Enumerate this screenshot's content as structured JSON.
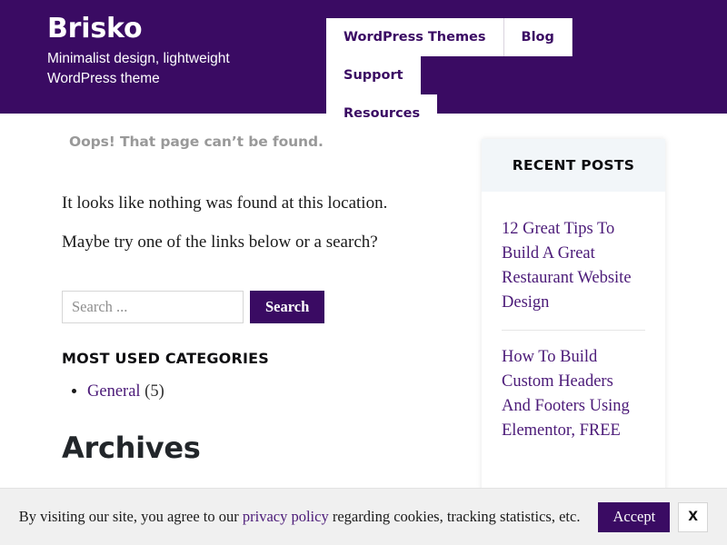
{
  "header": {
    "brand_title": "Brisko",
    "brand_tagline": "Minimalist design, lightweight WordPress theme",
    "nav": [
      {
        "label": "WordPress Themes"
      },
      {
        "label": "Blog"
      },
      {
        "label": "Support"
      },
      {
        "label": "Resources"
      }
    ]
  },
  "main": {
    "page_subtitle": "Oops! That page can’t be found.",
    "paragraph_1": "It looks like nothing was found at this location.",
    "paragraph_2": "Maybe try one of the links below or a search?",
    "search": {
      "placeholder": "Search ...",
      "value": "",
      "button_label": "Search"
    },
    "categories_widget": {
      "title": "Most used categories",
      "items": [
        {
          "label": "General",
          "count": "(5)"
        }
      ]
    },
    "archives_heading": "Archives"
  },
  "sidebar": {
    "title": "Recent Posts",
    "posts": [
      {
        "title": "12 Great Tips To Build A Great Restaurant Website Design"
      },
      {
        "title": "How To Build Custom Headers And Footers Using Elementor, FREE"
      }
    ]
  },
  "cookie_banner": {
    "text_before": "By visiting our site, you agree to our ",
    "link_label": "privacy policy",
    "text_after": " regarding cookies, tracking statistics, etc.",
    "accept_label": "Accept",
    "close_label": "X"
  },
  "colors": {
    "brand_purple": "#3a0b63",
    "link_purple": "#4b1a78",
    "sidebar_header_bg": "#f2f6f9",
    "banner_bg": "#f0f0f0",
    "muted_gray": "#999999"
  }
}
